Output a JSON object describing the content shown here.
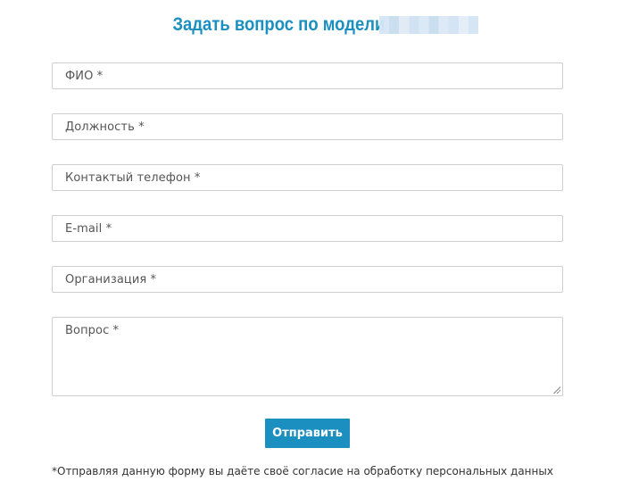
{
  "form": {
    "title": "Задать вопрос по модели",
    "fields": [
      {
        "placeholder": "ФИО *"
      },
      {
        "placeholder": "Должность *"
      },
      {
        "placeholder": "Контактый телефон *"
      },
      {
        "placeholder": "E-mail *"
      },
      {
        "placeholder": "Организация *"
      },
      {
        "placeholder": "Вопрос *"
      }
    ],
    "submit_label": "Отправить",
    "consent_text": "*Отправляя данную форму вы даёте своё согласие на обработку персональных данных"
  },
  "colors": {
    "accent": "#1a8fc0",
    "field_border": "#cfcfcf",
    "placeholder": "#555555"
  }
}
